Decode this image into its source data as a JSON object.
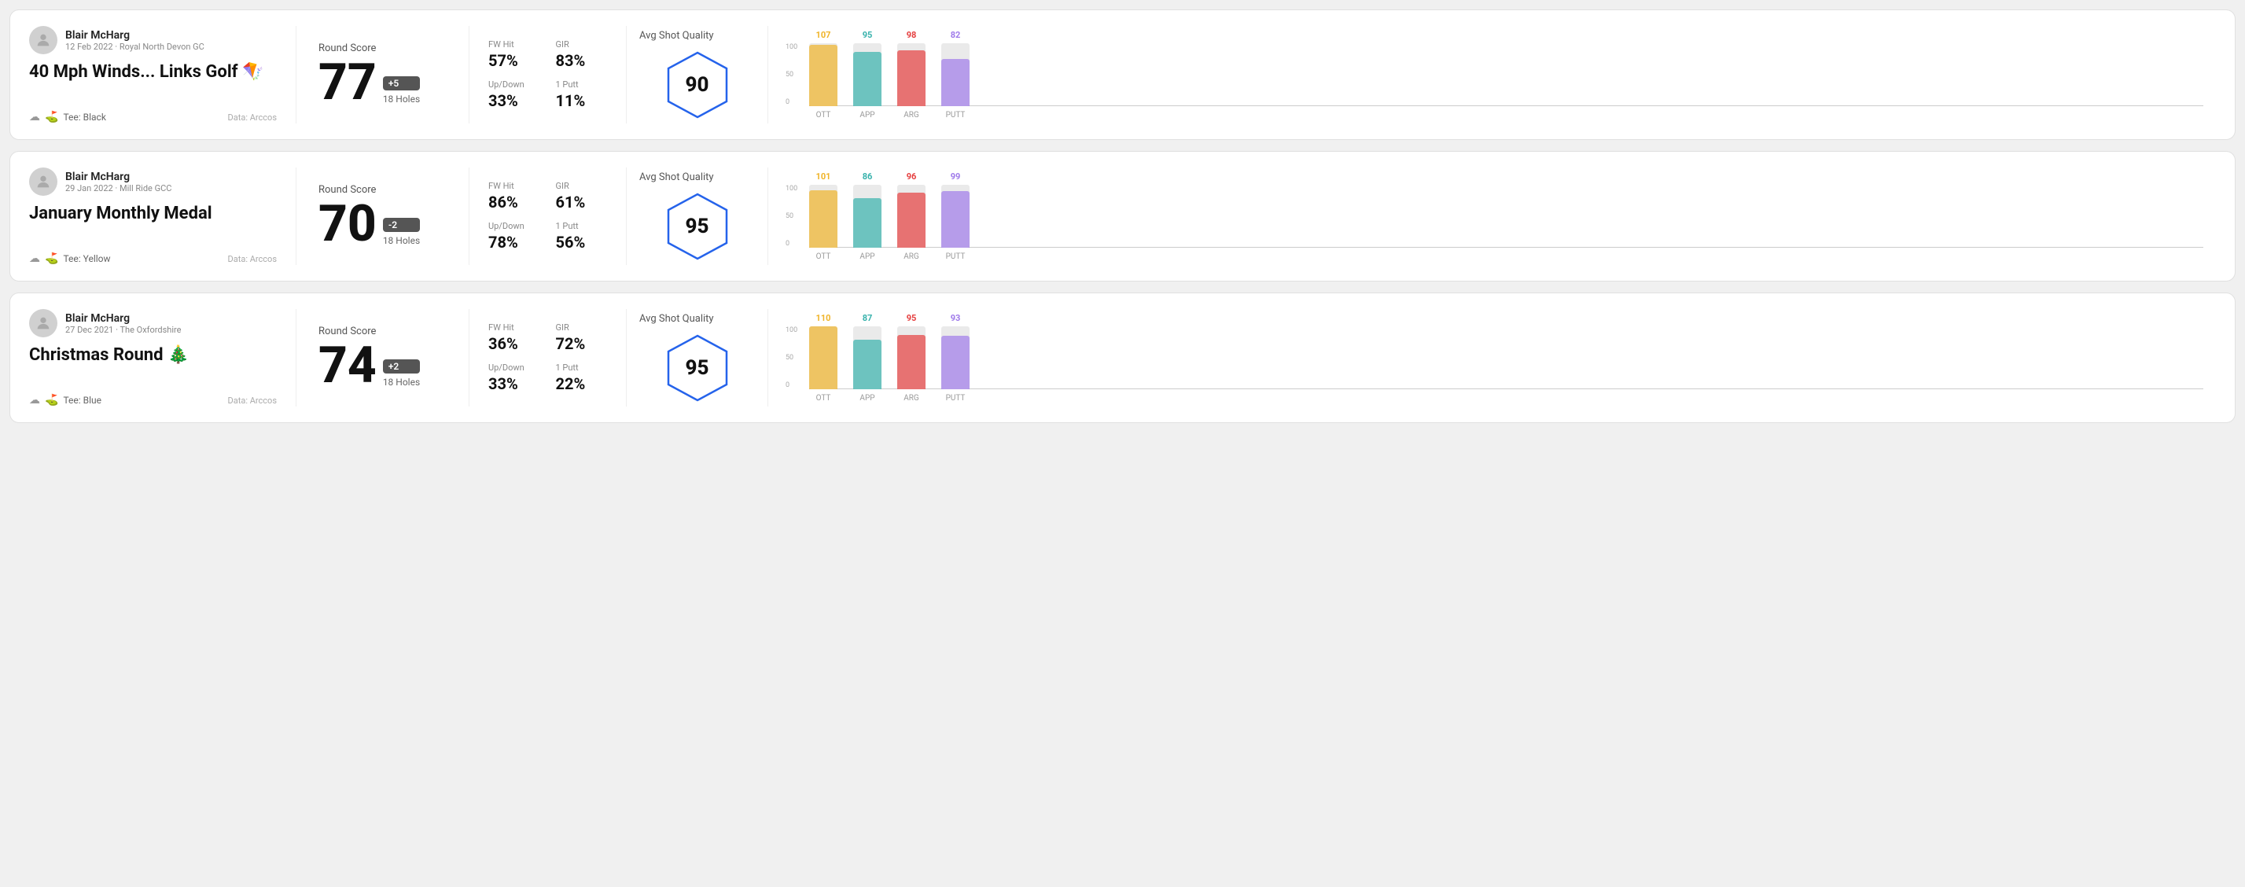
{
  "rounds": [
    {
      "id": "round1",
      "user": {
        "name": "Blair McHarg",
        "meta": "12 Feb 2022 · Royal North Devon GC"
      },
      "title": "40 Mph Winds... Links Golf 🪁",
      "tee": "Black",
      "data_source": "Data: Arccos",
      "score": {
        "label": "Round Score",
        "value": "77",
        "badge": "+5",
        "holes": "18 Holes"
      },
      "stats": {
        "fw_hit_label": "FW Hit",
        "fw_hit_value": "57%",
        "gir_label": "GIR",
        "gir_value": "83%",
        "up_down_label": "Up/Down",
        "up_down_value": "33%",
        "one_putt_label": "1 Putt",
        "one_putt_value": "11%"
      },
      "quality": {
        "label": "Avg Shot Quality",
        "score": "90"
      },
      "chart": {
        "bars": [
          {
            "label": "OTT",
            "value": 107,
            "color": "#f0b429",
            "percent": 85
          },
          {
            "label": "APP",
            "value": 95,
            "color": "#38b2ac",
            "percent": 68
          },
          {
            "label": "ARG",
            "value": 98,
            "color": "#e53e3e",
            "percent": 72
          },
          {
            "label": "PUTT",
            "value": 82,
            "color": "#9f7aea",
            "percent": 58
          }
        ],
        "max": 100,
        "y_labels": [
          "100",
          "50",
          "0"
        ]
      }
    },
    {
      "id": "round2",
      "user": {
        "name": "Blair McHarg",
        "meta": "29 Jan 2022 · Mill Ride GCC"
      },
      "title": "January Monthly Medal",
      "tee": "Yellow",
      "data_source": "Data: Arccos",
      "score": {
        "label": "Round Score",
        "value": "70",
        "badge": "-2",
        "holes": "18 Holes"
      },
      "stats": {
        "fw_hit_label": "FW Hit",
        "fw_hit_value": "86%",
        "gir_label": "GIR",
        "gir_value": "61%",
        "up_down_label": "Up/Down",
        "up_down_value": "78%",
        "one_putt_label": "1 Putt",
        "one_putt_value": "56%"
      },
      "quality": {
        "label": "Avg Shot Quality",
        "score": "95"
      },
      "chart": {
        "bars": [
          {
            "label": "OTT",
            "value": 101,
            "color": "#f0b429",
            "percent": 78
          },
          {
            "label": "APP",
            "value": 86,
            "color": "#38b2ac",
            "percent": 60
          },
          {
            "label": "ARG",
            "value": 96,
            "color": "#e53e3e",
            "percent": 72
          },
          {
            "label": "PUTT",
            "value": 99,
            "color": "#9f7aea",
            "percent": 76
          }
        ],
        "max": 100,
        "y_labels": [
          "100",
          "50",
          "0"
        ]
      }
    },
    {
      "id": "round3",
      "user": {
        "name": "Blair McHarg",
        "meta": "27 Dec 2021 · The Oxfordshire"
      },
      "title": "Christmas Round 🎄",
      "tee": "Blue",
      "data_source": "Data: Arccos",
      "score": {
        "label": "Round Score",
        "value": "74",
        "badge": "+2",
        "holes": "18 Holes"
      },
      "stats": {
        "fw_hit_label": "FW Hit",
        "fw_hit_value": "36%",
        "gir_label": "GIR",
        "gir_value": "72%",
        "up_down_label": "Up/Down",
        "up_down_value": "33%",
        "one_putt_label": "1 Putt",
        "one_putt_value": "22%"
      },
      "quality": {
        "label": "Avg Shot Quality",
        "score": "95"
      },
      "chart": {
        "bars": [
          {
            "label": "OTT",
            "value": 110,
            "color": "#f0b429",
            "percent": 88
          },
          {
            "label": "APP",
            "value": 87,
            "color": "#38b2ac",
            "percent": 62
          },
          {
            "label": "ARG",
            "value": 95,
            "color": "#e53e3e",
            "percent": 70
          },
          {
            "label": "PUTT",
            "value": 93,
            "color": "#9f7aea",
            "percent": 70
          }
        ],
        "max": 100,
        "y_labels": [
          "100",
          "50",
          "0"
        ]
      }
    }
  ],
  "labels": {
    "tee_prefix": "Tee:",
    "fw_hit": "FW Hit",
    "gir": "GIR",
    "up_down": "Up/Down",
    "one_putt": "1 Putt",
    "avg_shot_quality": "Avg Shot Quality",
    "round_score": "Round Score",
    "holes_18": "18 Holes"
  }
}
